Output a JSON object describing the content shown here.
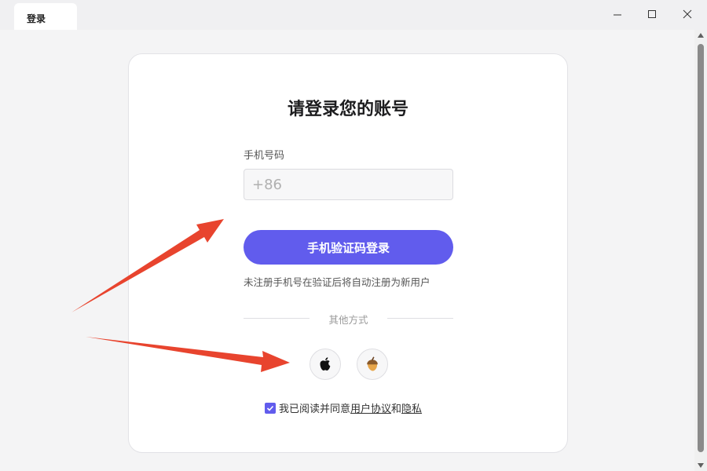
{
  "window": {
    "tab_title": "登录",
    "icons": {
      "minimize": "minimize-icon",
      "maximize": "maximize-icon",
      "close": "close-icon"
    }
  },
  "login": {
    "title": "请登录您的账号",
    "phone_label": "手机号码",
    "phone_placeholder": "+86",
    "login_button": "手机验证码登录",
    "hint": "未注册手机号在验证后将自动注册为新用户",
    "other_methods": "其他方式",
    "social": [
      {
        "name": "apple",
        "icon": "apple-icon"
      },
      {
        "name": "acorn",
        "icon": "acorn-icon"
      }
    ],
    "agreement": {
      "checked": true,
      "prefix": "我已阅读并同意",
      "user_agreement": "用户协议",
      "and": "和",
      "privacy": "隐私"
    }
  },
  "colors": {
    "accent": "#615ced",
    "annotation_arrow": "#e8442e"
  }
}
